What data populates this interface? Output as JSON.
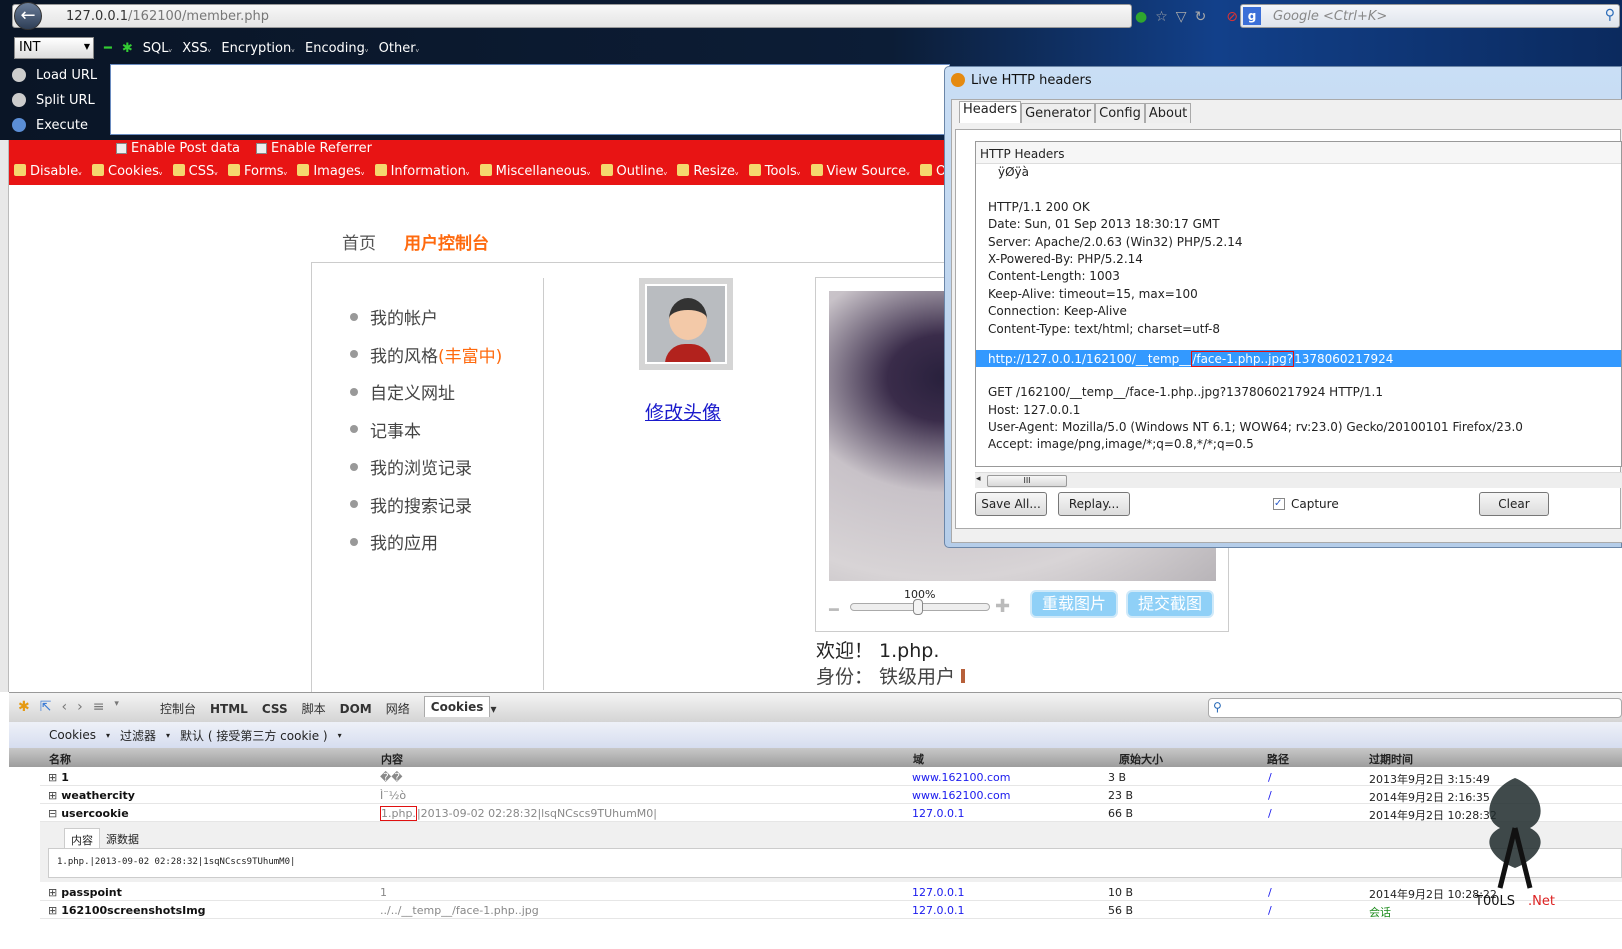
{
  "browser": {
    "url_host": "127.0.0.1",
    "url_path": "/162100/member.php",
    "search_placeholder": "Google <Ctrl+K>"
  },
  "hackbar": {
    "select_value": "INT",
    "menus": [
      "SQL",
      "XSS",
      "Encryption",
      "Encoding",
      "Other"
    ],
    "actions": [
      "Load URL",
      "Split URL",
      "Execute"
    ],
    "url_value": "",
    "checkboxes": [
      "Enable Post data",
      "Enable Referrer"
    ]
  },
  "webdev_toolbar": [
    "Disable",
    "Cookies",
    "CSS",
    "Forms",
    "Images",
    "Information",
    "Miscellaneous",
    "Outline",
    "Resize",
    "Tools",
    "View Source",
    "Options"
  ],
  "page": {
    "nav": [
      "首页",
      "用户控制台"
    ],
    "menu": [
      {
        "label": "我的帐户"
      },
      {
        "label": "我的风格",
        "extra": "(丰富中)"
      },
      {
        "label": "自定义网址"
      },
      {
        "label": "记事本"
      },
      {
        "label": "我的浏览记录"
      },
      {
        "label": "我的搜索记录"
      },
      {
        "label": "我的应用"
      }
    ],
    "edit_avatar": "修改头像",
    "zoom": "100%",
    "zoom_value": 100,
    "reload_btn": "重载图片",
    "submit_btn": "提交截图",
    "welcome": "欢迎！ 1.php.",
    "identity": "身份： 铁级用户"
  },
  "live_headers": {
    "title": "Live HTTP headers",
    "tabs": [
      "Headers",
      "Generator",
      "Config",
      "About"
    ],
    "active_tab": "Headers",
    "box_title": "HTTP Headers",
    "lines": [
      "ÿØÿà",
      "",
      "HTTP/1.1 200 OK",
      "Date: Sun, 01 Sep 2013 18:30:17 GMT",
      "Server: Apache/2.0.63 (Win32) PHP/5.2.14",
      "X-Powered-By: PHP/5.2.14",
      "Content-Length: 1003",
      "Keep-Alive: timeout=15, max=100",
      "Connection: Keep-Alive",
      "Content-Type: text/html; charset=utf-8"
    ],
    "selected_url_a": "http://127.0.0.1/162100/__temp__",
    "selected_url_b": "/face-1.php..jpg?",
    "selected_url_c": "1378060217924",
    "request_lines": [
      "GET /162100/__temp__/face-1.php..jpg?1378060217924 HTTP/1.1",
      "Host: 127.0.0.1",
      "User-Agent: Mozilla/5.0 (Windows NT 6.1; WOW64; rv:23.0) Gecko/20100101 Firefox/23.0",
      "Accept: image/png,image/*;q=0.8,*/*;q=0.5"
    ],
    "save_all": "Save All...",
    "replay": "Replay...",
    "capture": "Capture",
    "capture_checked": true,
    "clear": "Clear"
  },
  "firebug": {
    "tabs": [
      "控制台",
      "HTML",
      "CSS",
      "脚本",
      "DOM",
      "网络",
      "Cookies"
    ],
    "active_tab": "Cookies",
    "sub": [
      "Cookies",
      "过滤器",
      "默认 ( 接受第三方 cookie )"
    ],
    "columns": [
      "名称",
      "内容",
      "域",
      "原始大小",
      "路径",
      "过期时间"
    ],
    "rows": [
      {
        "name": "1",
        "content": "��",
        "domain": "www.162100.com",
        "size": "3 B",
        "path": "/",
        "expires": "2013年9月2日 3:15:49"
      },
      {
        "name": "weathercity",
        "content": "Ì¨½ò",
        "domain": "www.162100.com",
        "size": "23 B",
        "path": "/",
        "expires": "2014年9月2日 2:16:35"
      },
      {
        "name": "usercookie",
        "content_a": "1.php.",
        "content": "|2013-09-02 02:28:32|lsqNCscs9TUhumM0|",
        "domain": "127.0.0.1",
        "size": "66 B",
        "path": "/",
        "expires": "2014年9月2日 10:28:32"
      },
      {
        "name": "passpoint",
        "content": "1",
        "domain": "127.0.0.1",
        "size": "10 B",
        "path": "/",
        "expires": "2014年9月2日 10:28:22"
      },
      {
        "name": "162100screenshotsImg",
        "content": "../../__temp__/face-1.php..jpg",
        "domain": "127.0.0.1",
        "size": "56 B",
        "path": "/",
        "expires": "会话"
      }
    ],
    "detail_tabs": [
      "内容",
      "源数据"
    ],
    "detail_value": "1.php.|2013-09-02 02:28:32|1sqNCscs9TUhumM0|"
  },
  "watermark": "T00LS.Net",
  "colors": {
    "accent": "#ff6a0e",
    "red_toolbar": "#e81414",
    "selection": "#3399ff",
    "link": "#1a1aee"
  }
}
